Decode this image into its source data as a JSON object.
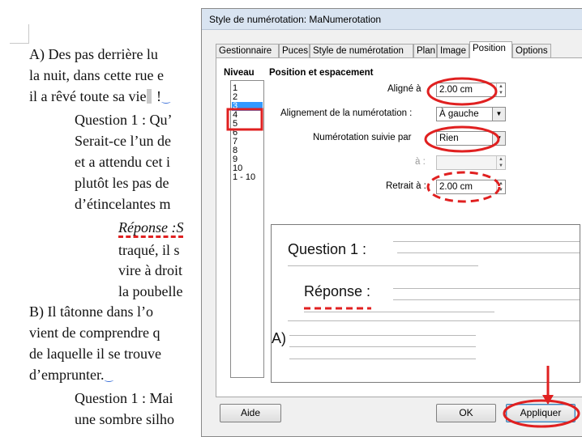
{
  "document": {
    "lines": [
      {
        "pre": "A)  Des pas derrière lu",
        "post": ""
      },
      {
        "pre": "la nuit, dans cette rue e",
        "post": ""
      },
      {
        "pre": "il a rêvé toute sa vie",
        "post": " !"
      },
      {
        "pre": "Question 1 : Qu’",
        "post": ""
      },
      {
        "pre": "Serait-ce l’un de",
        "post": ""
      },
      {
        "pre": "et a attendu cet i",
        "post": ""
      },
      {
        "pre": "plutôt les pas de",
        "post": ""
      },
      {
        "pre": "d’étincelantes m",
        "post": ""
      },
      {
        "pre": "Réponse :S",
        "post": ""
      },
      {
        "pre": "traqué, il s",
        "post": ""
      },
      {
        "pre": "vire à droit",
        "post": ""
      },
      {
        "pre": "la poubelle",
        "post": ""
      },
      {
        "pre": "B)  Il tâtonne dans l’o",
        "post": ""
      },
      {
        "pre": "vient de comprendre q",
        "post": ""
      },
      {
        "pre": "de laquelle il se trouve",
        "post": ""
      },
      {
        "pre": "d’emprunter.",
        "post": ""
      },
      {
        "pre": "Question 1 : Mai",
        "post": ""
      },
      {
        "pre": "une sombre silho",
        "post": ""
      }
    ]
  },
  "dialog": {
    "title": "Style de numérotation: MaNumerotation",
    "tabs": [
      "Gestionnaire",
      "Puces",
      "Style de numérotation",
      "Plan",
      "Image",
      "Position",
      "Options"
    ],
    "active_tab": "Position",
    "niveau_label": "Niveau",
    "levels": [
      "1",
      "2",
      "3",
      "4",
      "5",
      "6",
      "7",
      "8",
      "9",
      "10",
      "1 - 10"
    ],
    "selected_level": "3",
    "section_title": "Position et espacement",
    "fields": {
      "aligne_label": "Aligné à",
      "aligne_value": "2.00 cm",
      "alignement_label": "Alignement de la numérotation :",
      "alignement_value": "À gauche",
      "suivie_label": "Numérotation suivie par",
      "suivie_value": "Rien",
      "a_label": "à :",
      "a_value": "",
      "retrait_label": "Retrait à :",
      "retrait_value": "2.00 cm"
    },
    "preview": {
      "question": "Question 1 :",
      "reponse": "Réponse :",
      "a_label": "A)"
    },
    "buttons": {
      "aide": "Aide",
      "ok": "OK",
      "appliquer": "Appliquer"
    }
  },
  "colors": {
    "annotation_red": "#e02020",
    "selection_blue": "#3399ff",
    "titlebar": "#d9e4f1"
  }
}
